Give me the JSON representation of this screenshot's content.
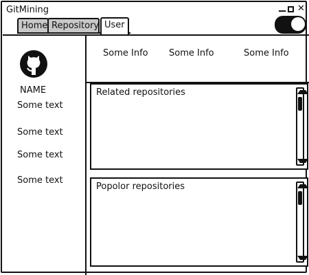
{
  "app": {
    "title": "GitMining"
  },
  "tabs": [
    {
      "label": "Home"
    },
    {
      "label": "Repository"
    },
    {
      "label": "User"
    }
  ],
  "sidebar": {
    "name": "NAME",
    "texts": [
      "Some text",
      "Some text",
      "Some text",
      "Some text"
    ]
  },
  "info": [
    "Some Info",
    "Some Info",
    "Some Info"
  ],
  "panels": {
    "related_title": "Related repositories",
    "popular_title": "Popolor repositories"
  },
  "colors": {
    "ink": "#111111",
    "inactive_tab": "#c8c8c8"
  }
}
